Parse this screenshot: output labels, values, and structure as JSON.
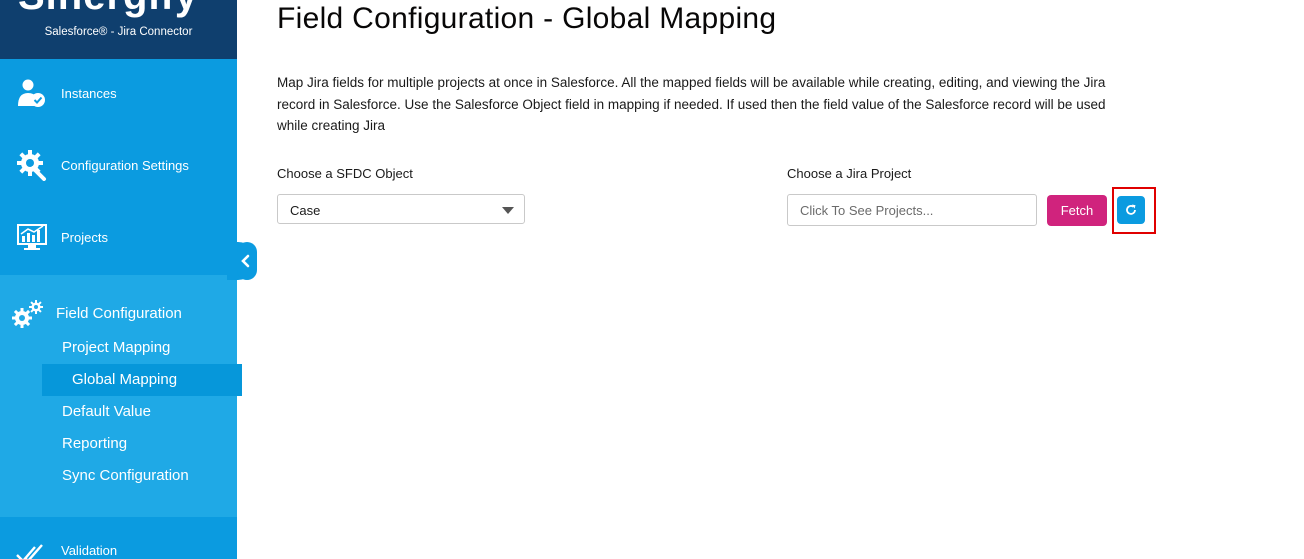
{
  "brand": {
    "logo_text": "Sinergify",
    "subtitle": "Salesforce® - Jira Connector"
  },
  "sidebar": {
    "items": [
      {
        "label": "Instances",
        "icon": "user-check-icon"
      },
      {
        "label": "Configuration Settings",
        "icon": "gear-wrench-icon"
      },
      {
        "label": "Projects",
        "icon": "chart-monitor-icon"
      }
    ],
    "group": {
      "label": "Field Configuration",
      "icon": "gears-icon",
      "sub_items": [
        {
          "label": "Project Mapping"
        },
        {
          "label": "Global Mapping",
          "active": true
        },
        {
          "label": "Default Value"
        },
        {
          "label": "Reporting"
        },
        {
          "label": "Sync Configuration"
        }
      ]
    },
    "bottom_item": {
      "label": "Validation",
      "icon": "double-check-icon"
    }
  },
  "main": {
    "title": "Field Configuration - Global Mapping",
    "description": "Map Jira fields for multiple projects at once in Salesforce. All the mapped fields will be available while creating, editing, and viewing the Jira record in Salesforce. Use the Salesforce Object field in mapping if needed. If used then the field value of the Salesforce record will be used while creating Jira",
    "sfdc_label": "Choose a SFDC Object",
    "sfdc_value": "Case",
    "jira_label": "Choose a Jira Project",
    "jira_placeholder": "Click To See Projects...",
    "fetch_label": "Fetch",
    "refresh_icon": "refresh-icon"
  },
  "colors": {
    "sidebar": "#0b9be0",
    "sidebar_group": "#1fa9e6",
    "brand_bg": "#0f3f6e",
    "fetch": "#d0237d",
    "highlight_frame": "#e00000"
  }
}
